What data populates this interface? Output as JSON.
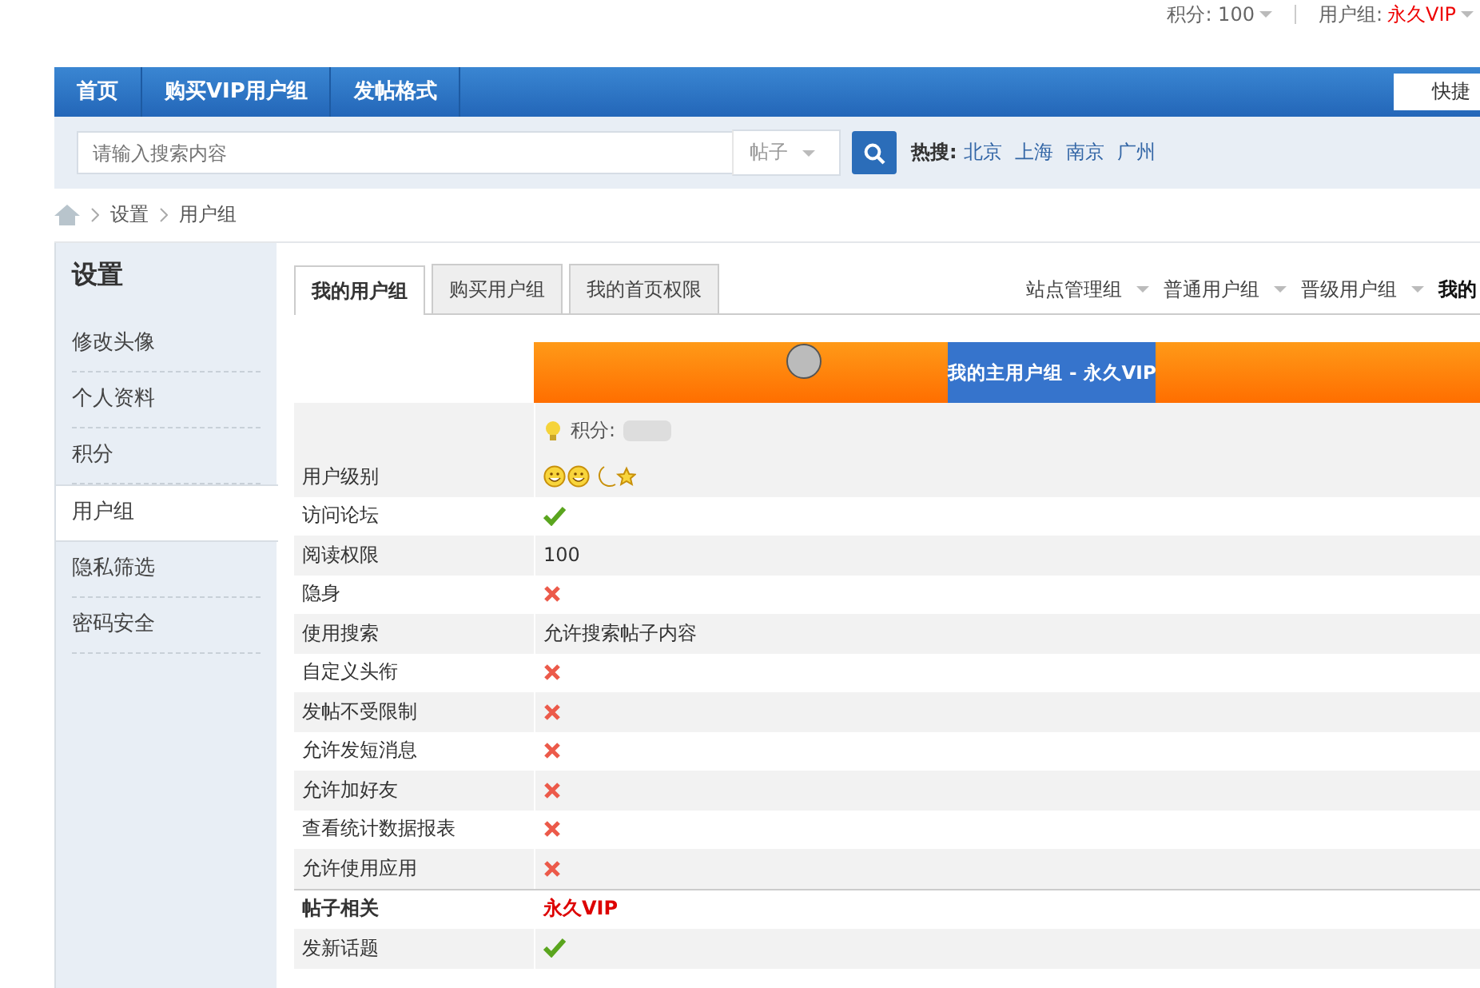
{
  "top_bar": {
    "points": "积分: 100",
    "group_label": "用户组:",
    "group_value": "永久VIP"
  },
  "nav": {
    "items": [
      {
        "label": "首页",
        "selected": false
      },
      {
        "label": "购买VIP用户组",
        "selected": false
      },
      {
        "label": "发帖格式",
        "selected": false
      }
    ],
    "quick_button": "快捷"
  },
  "search": {
    "placeholder": "请输入搜索内容",
    "scope": "帖子",
    "hot_label": "热搜:",
    "hot_words": [
      "北京",
      "上海",
      "南京",
      "广州"
    ]
  },
  "breadcrumb": [
    "设置",
    "用户组"
  ],
  "sidebar": {
    "title": "设置",
    "items": [
      {
        "label": "修改头像",
        "selected": false
      },
      {
        "label": "个人资料",
        "selected": false
      },
      {
        "label": "积分",
        "selected": false
      },
      {
        "label": "用户组",
        "selected": true
      },
      {
        "label": "隐私筛选",
        "selected": false
      },
      {
        "label": "密码安全",
        "selected": false
      }
    ]
  },
  "tabs": [
    {
      "label": "我的用户组",
      "selected": true
    },
    {
      "label": "购买用户组",
      "selected": false
    },
    {
      "label": "我的首页权限",
      "selected": false
    }
  ],
  "group_links": [
    "站点管理组",
    "普通用户组",
    "晋级用户组",
    "我的"
  ],
  "banner": {
    "title": "我的主用户组 - 永久VIP"
  },
  "points_label": "积分:",
  "rows": [
    {
      "label": "用户级别",
      "kind": "level"
    },
    {
      "label": "访问论坛",
      "kind": "yes"
    },
    {
      "label": "阅读权限",
      "kind": "text",
      "value": "100"
    },
    {
      "label": "隐身",
      "kind": "no"
    },
    {
      "label": "使用搜索",
      "kind": "text",
      "value": "允许搜索帖子内容"
    },
    {
      "label": "自定义头衔",
      "kind": "no"
    },
    {
      "label": "发帖不受限制",
      "kind": "no"
    },
    {
      "label": "允许发短消息",
      "kind": "no"
    },
    {
      "label": "允许加好友",
      "kind": "no"
    },
    {
      "label": "查看统计数据报表",
      "kind": "no"
    },
    {
      "label": "允许使用应用",
      "kind": "no"
    },
    {
      "label": "帖子相关",
      "kind": "header",
      "value": "永久VIP"
    },
    {
      "label": "发新话题",
      "kind": "yes"
    }
  ]
}
